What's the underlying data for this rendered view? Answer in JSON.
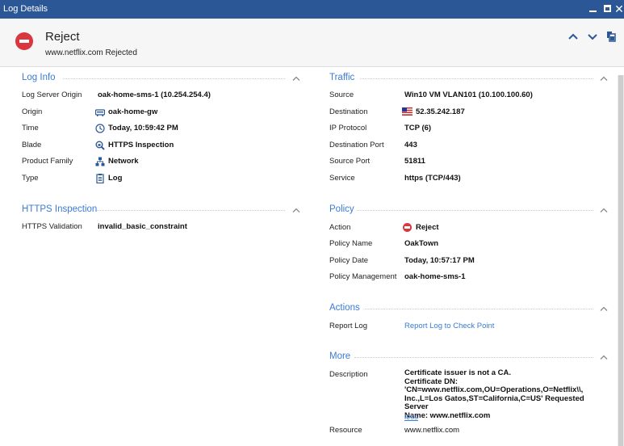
{
  "window": {
    "title": "Log Details"
  },
  "header": {
    "title": "Reject",
    "subtitle": "www.netflix.com Rejected"
  },
  "log_info": {
    "title": "Log Info",
    "rows": [
      {
        "label": "Log Server Origin",
        "value": "oak-home-sms-1 (10.254.254.4)"
      },
      {
        "label": "Origin",
        "value": "oak-home-gw"
      },
      {
        "label": "Time",
        "value": "Today, 10:59:42 PM"
      },
      {
        "label": "Blade",
        "value": "HTTPS Inspection"
      },
      {
        "label": "Product Family",
        "value": "Network"
      },
      {
        "label": "Type",
        "value": "Log"
      }
    ]
  },
  "https_inspection": {
    "title": "HTTPS Inspection",
    "rows": [
      {
        "label": "HTTPS Validation",
        "value": "invalid_basic_constraint"
      }
    ]
  },
  "traffic": {
    "title": "Traffic",
    "rows": [
      {
        "label": "Source",
        "value": "Win10 VM VLAN101 (10.100.100.60)"
      },
      {
        "label": "Destination",
        "value": "52.35.242.187"
      },
      {
        "label": "IP Protocol",
        "value": "TCP (6)"
      },
      {
        "label": "Destination Port",
        "value": "443"
      },
      {
        "label": "Source Port",
        "value": "51811"
      },
      {
        "label": "Service",
        "value": "https (TCP/443)"
      }
    ]
  },
  "policy": {
    "title": "Policy",
    "rows": [
      {
        "label": "Action",
        "value": "Reject"
      },
      {
        "label": "Policy Name",
        "value": "OakTown"
      },
      {
        "label": "Policy Date",
        "value": "Today, 10:57:17 PM"
      },
      {
        "label": "Policy Management",
        "value": "oak-home-sms-1"
      }
    ]
  },
  "actions": {
    "title": "Actions",
    "rows": [
      {
        "label": "Report Log",
        "value": "Report Log to Check Point"
      }
    ]
  },
  "more": {
    "title": "More",
    "description_label": "Description",
    "description_value": "Certificate issuer is not a CA.\n    Certificate DN:\n'CN=www.netflix.com,OU=Operations,O=Netflix\\\\,\nInc.,L=Los Gatos,ST=California,C=US'  Requested Server\nName: www.netflix.com",
    "less_label": "less",
    "resource_label": "Resource",
    "resource_value": "www.netflix.com"
  },
  "colors": {
    "titlebar": "#2b5797",
    "accent": "#3a7bd5",
    "reject": "#d9363e"
  },
  "icons": {
    "origin": "gateway-icon",
    "time": "clock-icon",
    "blade": "https-inspection-icon",
    "product_family": "network-icon",
    "type": "log-icon",
    "destination": "us-flag-icon",
    "action": "reject-icon"
  }
}
